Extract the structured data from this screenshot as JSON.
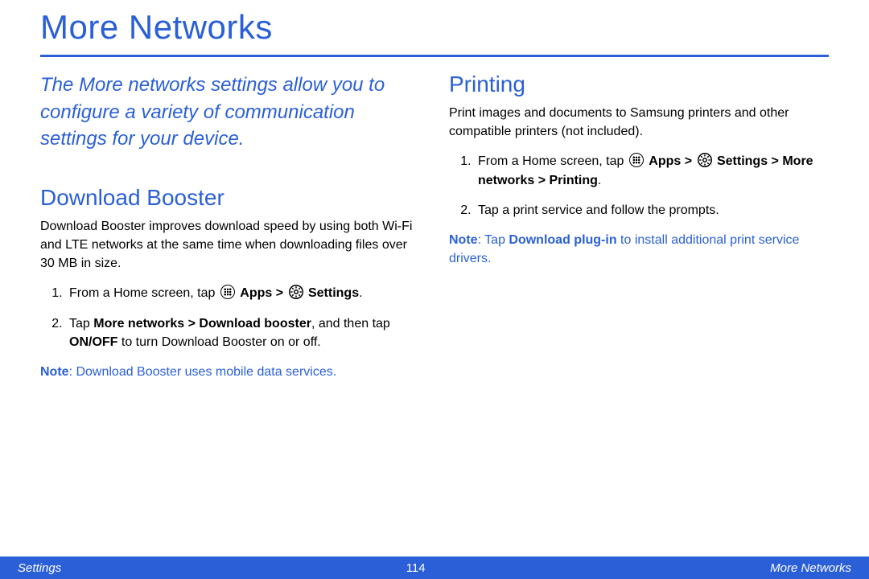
{
  "title": "More Networks",
  "intro": "The More networks settings allow you to configure a variety of communication settings for your device.",
  "left": {
    "heading": "Download Booster",
    "desc": "Download Booster improves download speed by using both Wi-Fi and LTE networks at the same time when downloading files over 30 MB in size.",
    "s1_a": "From a Home screen, tap ",
    "s1_b": "Apps > ",
    "s1_c": "Settings",
    "s1_d": ".",
    "s2_a": "Tap ",
    "s2_b": "More networks > Download booster",
    "s2_c": ", and then tap ",
    "s2_d": "ON/OFF",
    "s2_e": " to turn Download Booster on or off.",
    "note_label": "Note",
    "note_body": ": Download Booster uses mobile data services."
  },
  "right": {
    "heading": "Printing",
    "desc": "Print images and documents to Samsung printers and other compatible printers (not included).",
    "s1_a": "From a Home screen, tap ",
    "s1_b": "Apps > ",
    "s1_c": "Settings > More networks > Printing",
    "s1_d": ".",
    "s2": "Tap a print service and follow the prompts.",
    "note_label": "Note",
    "note_a": ": Tap ",
    "note_b": "Download plug-in",
    "note_c": " to install additional print service drivers."
  },
  "footer": {
    "left": "Settings",
    "center": "114",
    "right": "More Networks"
  }
}
